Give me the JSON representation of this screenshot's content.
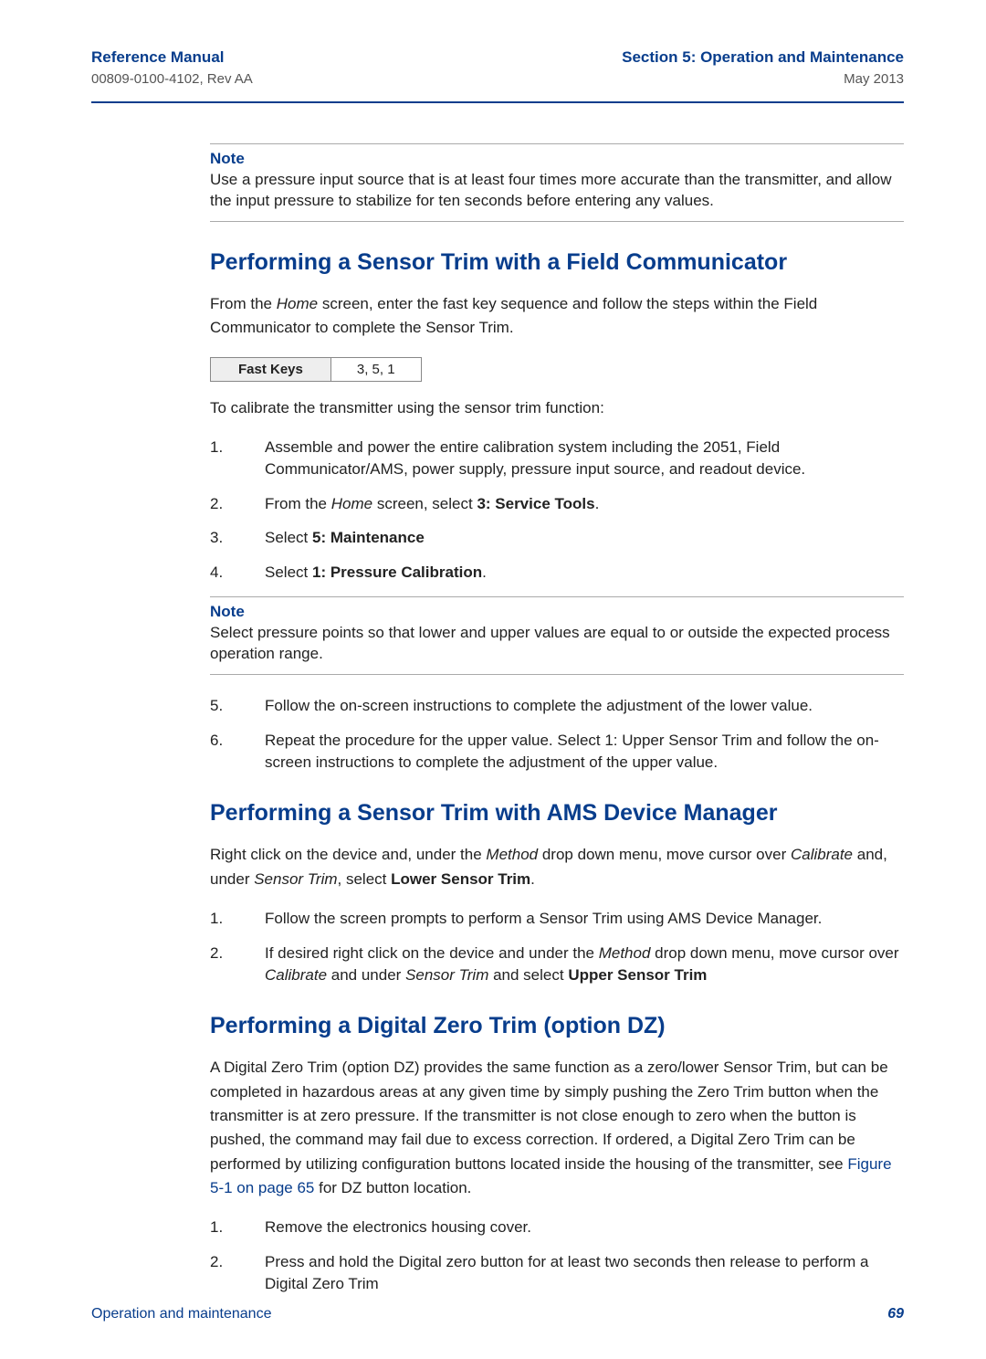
{
  "header": {
    "left_title": "Reference Manual",
    "left_sub": "00809-0100-4102, Rev AA",
    "right_title": "Section 5: Operation and Maintenance",
    "right_sub": "May 2013"
  },
  "note1": {
    "label": "Note",
    "body": "Use a pressure input source that is at least four times more accurate than the transmitter, and allow the input pressure to stabilize for ten seconds before entering any values."
  },
  "sec1": {
    "title": "Performing a Sensor Trim with a Field Communicator",
    "intro_pre": "From the ",
    "intro_home": "Home",
    "intro_post": " screen, enter the fast key sequence and follow the steps within the Field Communicator to complete the Sensor Trim.",
    "fastkeys_label": "Fast Keys",
    "fastkeys_value": "3, 5, 1",
    "intro2": "To calibrate the transmitter using the sensor trim function:",
    "steps": {
      "s1": {
        "n": "1.",
        "text": "Assemble and power the entire calibration system including the 2051, Field Communicator/AMS, power supply, pressure input source, and readout device."
      },
      "s2": {
        "n": "2.",
        "pre": "From the ",
        "home": "Home",
        "mid": " screen, select ",
        "bold": "3: Service Tools",
        "post": "."
      },
      "s3": {
        "n": "3.",
        "pre": "Select ",
        "bold": "5: Maintenance"
      },
      "s4": {
        "n": "4.",
        "pre": "Select ",
        "bold": "1: Pressure Calibration",
        "post": "."
      }
    }
  },
  "note2": {
    "label": "Note",
    "body": "Select pressure points so that lower and upper values are equal to or outside the expected process operation range."
  },
  "sec1b_steps": {
    "s5": {
      "n": "5.",
      "text": "Follow the on-screen instructions to complete the adjustment of the lower value."
    },
    "s6": {
      "n": "6.",
      "text": "Repeat the procedure for the upper value. Select 1: Upper Sensor Trim and follow the on-screen instructions to complete the adjustment of the upper value."
    }
  },
  "sec2": {
    "title": "Performing a Sensor Trim with AMS Device Manager",
    "intro_1": "Right click on the device and, under the ",
    "intro_method": "Method",
    "intro_2": " drop down menu, move cursor over ",
    "intro_calibrate": "Calibrate",
    "intro_3": " and, under ",
    "intro_sensor_trim": "Sensor Trim",
    "intro_4": ", select ",
    "intro_bold": "Lower Sensor Trim",
    "intro_5": ".",
    "steps": {
      "s1": {
        "n": "1.",
        "text": "Follow the screen prompts to perform a Sensor Trim using AMS Device Manager."
      },
      "s2": {
        "n": "2.",
        "a": "If desired right click on the device and under the ",
        "method": "Method",
        "b": " drop down menu, move cursor over ",
        "calibrate": "Calibrate",
        "c": " and under ",
        "sensor_trim": "Sensor Trim",
        "d": " and select ",
        "bold": "Upper Sensor Trim"
      }
    }
  },
  "sec3": {
    "title": "Performing a Digital Zero Trim (option DZ)",
    "para_a": "A Digital Zero Trim (option DZ) provides the same function as a zero/lower Sensor Trim, but can be completed in hazardous areas at any given time by simply pushing the Zero Trim button when the transmitter is at zero pressure. If the transmitter is not close enough to zero when the button is pushed, the command may fail due to excess correction. If ordered, a Digital Zero Trim can be performed by utilizing configuration buttons located inside the housing of the transmitter, see ",
    "para_link": "Figure 5-1 on page 65",
    "para_b": " for DZ button location.",
    "steps": {
      "s1": {
        "n": "1.",
        "text": "Remove the electronics housing cover."
      },
      "s2": {
        "n": "2.",
        "text": "Press and hold the Digital zero button for at least two seconds then release to perform a Digital Zero Trim"
      }
    }
  },
  "footer": {
    "left": "Operation and maintenance",
    "right": "69"
  }
}
